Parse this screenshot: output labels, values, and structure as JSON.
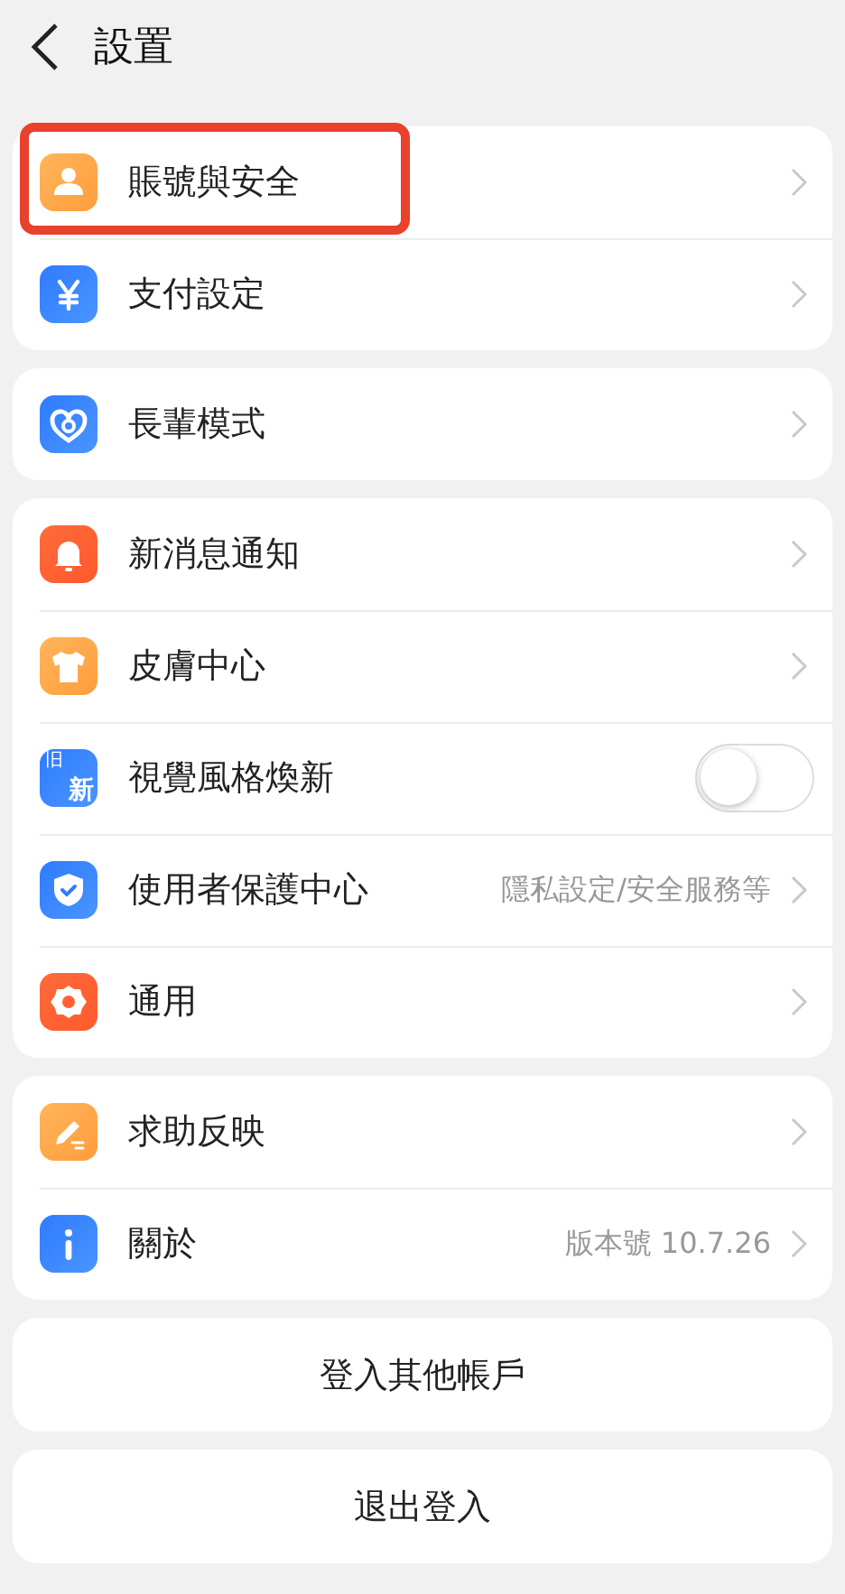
{
  "header": {
    "title": "設置"
  },
  "groups": [
    {
      "items": [
        {
          "kind": "link",
          "label": "賬號與安全",
          "highlighted": true
        },
        {
          "kind": "link",
          "label": "支付設定",
          "highlighted": false
        }
      ]
    },
    {
      "items": [
        {
          "kind": "link",
          "label": "長輩模式",
          "highlighted": false
        }
      ]
    },
    {
      "items": [
        {
          "kind": "link",
          "label": "新消息通知",
          "highlighted": false
        },
        {
          "kind": "link",
          "label": "皮膚中心",
          "highlighted": false
        },
        {
          "kind": "toggle",
          "label": "視覺風格煥新",
          "on": false,
          "highlighted": false,
          "icon_labels": [
            "旧",
            "新"
          ]
        },
        {
          "kind": "link",
          "label": "使用者保護中心",
          "value": "隱私設定/安全服務等",
          "highlighted": false
        },
        {
          "kind": "link",
          "label": "通用",
          "highlighted": false
        }
      ]
    },
    {
      "items": [
        {
          "kind": "link",
          "label": "求助反映",
          "highlighted": false
        },
        {
          "kind": "link",
          "label": "關於",
          "value": "版本號 10.7.26",
          "highlighted": false
        }
      ]
    }
  ],
  "buttons": [
    "登入其他帳戶",
    "退出登入"
  ]
}
